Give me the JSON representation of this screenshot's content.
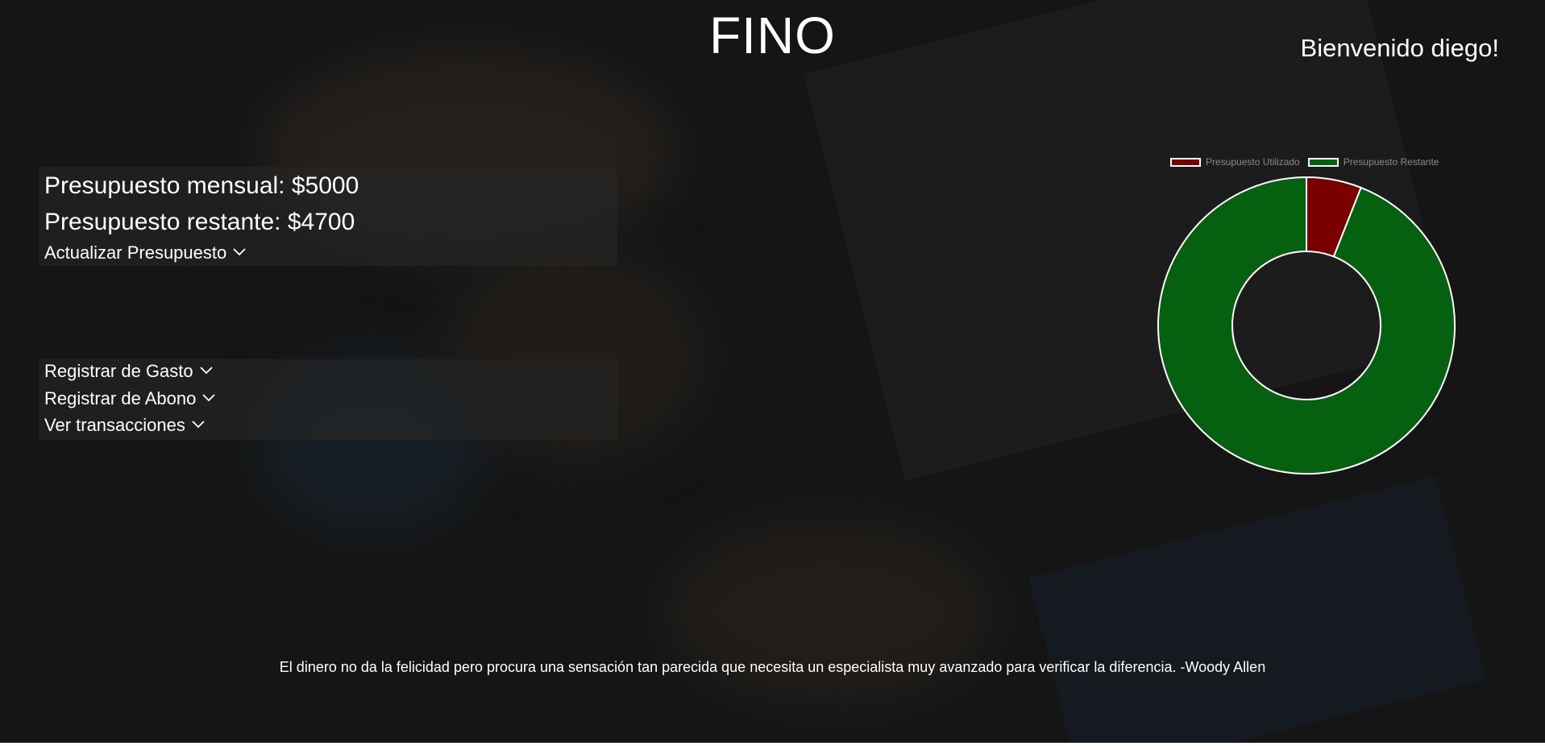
{
  "header": {
    "app_title": "FINO",
    "welcome": "Bienvenido diego!"
  },
  "budget": {
    "monthly_label": "Presupuesto mensual: $5000",
    "remaining_label": "Presupuesto restante: $4700",
    "update_link": "Actualizar Presupuesto"
  },
  "actions": {
    "register_expense": "Registrar de Gasto",
    "register_payment": "Registrar de Abono",
    "view_transactions": "Ver transacciones"
  },
  "chart_data": {
    "type": "pie",
    "variant": "doughnut",
    "categories": [
      "Presupuesto Utilizado",
      "Presupuesto Restante"
    ],
    "values": [
      300,
      4700
    ],
    "colors": [
      "#7a0000",
      "#056010"
    ],
    "legend_position": "top"
  },
  "footer": {
    "quote": "El dinero no da la felicidad pero procura una sensación tan parecida que necesita un especialista muy avanzado para verificar la diferencia. -Woody Allen"
  },
  "icons": {
    "dropdown": "chevron-down-icon"
  }
}
